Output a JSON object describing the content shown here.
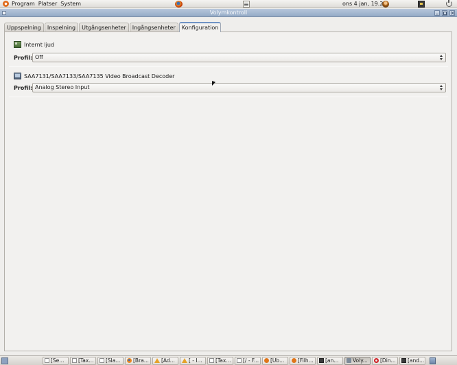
{
  "top_panel": {
    "menus": [
      "Program",
      "Platser",
      "System"
    ],
    "clock": "ons  4 jan, 19.24"
  },
  "window": {
    "title": "Volymkontroll",
    "tabs": [
      {
        "label": "Uppspelning",
        "active": false
      },
      {
        "label": "Inspelning",
        "active": false
      },
      {
        "label": "Utgångsenheter",
        "active": false
      },
      {
        "label": "Ingångsenheter",
        "active": false
      },
      {
        "label": "Konfiguration",
        "active": true
      }
    ],
    "devices": [
      {
        "name": "Internt ljud",
        "icon": "audio-card-icon",
        "profile_label": "Profil:",
        "profile_value": "Off"
      },
      {
        "name": "SAA7131/SAA7133/SAA7135 Video Broadcast Decoder",
        "icon": "tv-card-icon",
        "profile_label": "Profil:",
        "profile_value": "Analog Stereo Input"
      }
    ]
  },
  "taskbar": {
    "tasks": [
      {
        "label": "[Se...",
        "icon": "document-icon",
        "active": false
      },
      {
        "label": "[Tax...",
        "icon": "document-icon",
        "active": false
      },
      {
        "label": "[Sla...",
        "icon": "document-icon",
        "active": false
      },
      {
        "label": "[Bra...",
        "icon": "firefox-icon",
        "active": false
      },
      {
        "label": "[Ad...",
        "icon": "warning-icon",
        "active": false
      },
      {
        "label": "[ - I...",
        "icon": "warning-icon",
        "active": false
      },
      {
        "label": "[Tax...",
        "icon": "document-icon",
        "active": false
      },
      {
        "label": "[/ - F...",
        "icon": "document-icon",
        "active": false
      },
      {
        "label": "[Ub...",
        "icon": "ubuntu-icon",
        "active": false
      },
      {
        "label": "[Filh...",
        "icon": "ubuntu-icon",
        "active": false
      },
      {
        "label": "[an...",
        "icon": "terminal-icon",
        "active": false
      },
      {
        "label": "Voly...",
        "icon": "volume-icon",
        "active": true
      },
      {
        "label": "[Din...",
        "icon": "opera-icon",
        "active": false
      },
      {
        "label": "[and...",
        "icon": "terminal-icon",
        "active": false
      }
    ]
  }
}
